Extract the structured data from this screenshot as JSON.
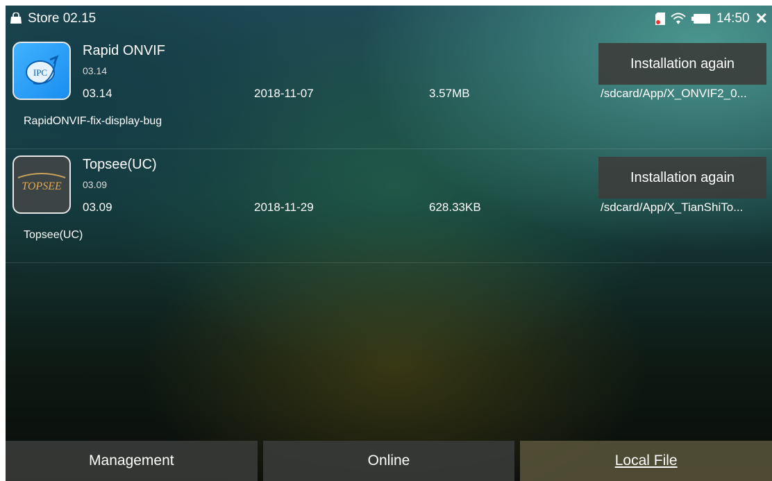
{
  "status_bar": {
    "title": "Store 02.15",
    "time": "14:50",
    "icons": [
      "bag-icon",
      "sd-card-icon",
      "wifi-icon",
      "battery-icon",
      "close-icon"
    ],
    "close_glyph": "✕"
  },
  "apps": [
    {
      "name": "Rapid ONVIF",
      "version_small": "03.14",
      "version": "03.14",
      "date": "2018-11-07",
      "size": "3.57MB",
      "path": "/sdcard/App/X_ONVIF2_0...",
      "description": "RapidONVIF-fix-display-bug",
      "button_label": "Installation again",
      "icon_text": "IPC"
    },
    {
      "name": "Topsee(UC)",
      "version_small": "03.09",
      "version": "03.09",
      "date": "2018-11-29",
      "size": "628.33KB",
      "path": "/sdcard/App/X_TianShiTo...",
      "description": "Topsee(UC)",
      "button_label": "Installation again",
      "icon_text": "TOPSEE"
    }
  ],
  "tabs": [
    {
      "label": "Management",
      "active": false
    },
    {
      "label": "Online",
      "active": false
    },
    {
      "label": "Local File",
      "active": true
    }
  ]
}
